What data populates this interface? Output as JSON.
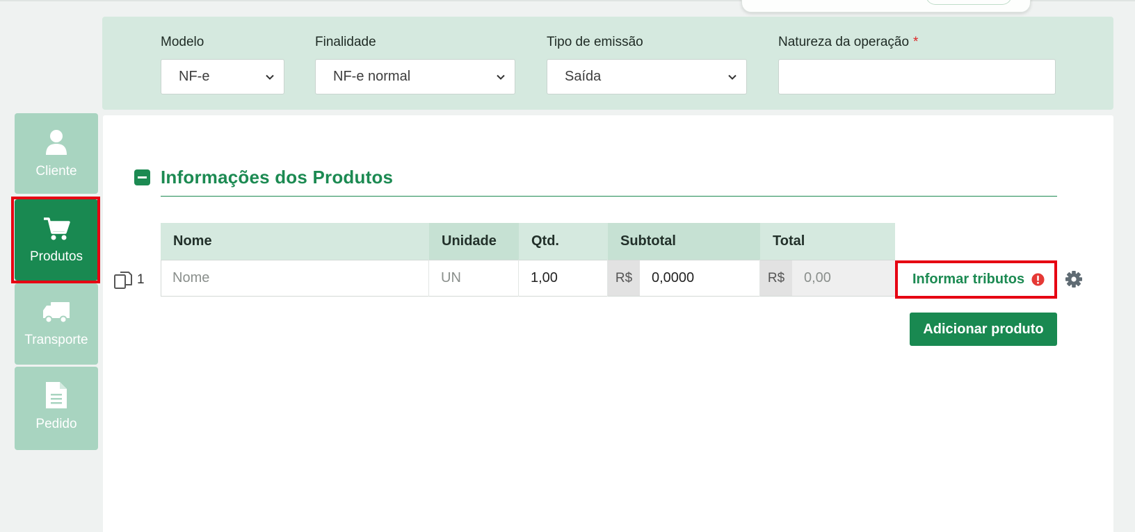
{
  "header": {
    "modelo": {
      "label": "Modelo",
      "value": "NF-e"
    },
    "finalidade": {
      "label": "Finalidade",
      "value": "NF-e normal"
    },
    "tipo_emissao": {
      "label": "Tipo de emissão",
      "value": "Saída"
    },
    "natureza": {
      "label": "Natureza da operação",
      "required_mark": "*",
      "value": ""
    }
  },
  "sidebar": {
    "items": [
      {
        "label": "Cliente",
        "icon": "user-icon",
        "active": false
      },
      {
        "label": "Produtos",
        "icon": "cart-icon",
        "active": true
      },
      {
        "label": "Transporte",
        "icon": "truck-icon",
        "active": false
      },
      {
        "label": "Pedido",
        "icon": "document-icon",
        "active": false
      }
    ]
  },
  "products": {
    "title": "Informações dos Produtos",
    "columns": [
      "Nome",
      "Unidade",
      "Qtd.",
      "Subtotal",
      "Total"
    ],
    "rows": [
      {
        "index": "1",
        "nome_placeholder": "Nome",
        "unidade_placeholder": "UN",
        "qtd": "1,00",
        "currency": "R$",
        "subtotal": "0,0000",
        "total": "0,00"
      }
    ],
    "informar_tributos": "Informar tributos",
    "add_button": "Adicionar produto"
  },
  "colors": {
    "brand_green": "#198951",
    "panel_green": "#d5e9df",
    "sidebar_green": "#a8d4c0",
    "highlight_red": "#e60012",
    "alert_red": "#e53935"
  }
}
